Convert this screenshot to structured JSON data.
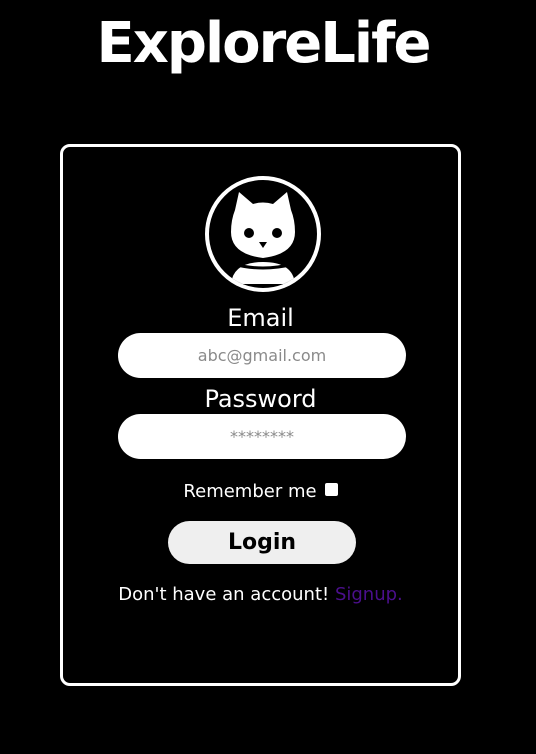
{
  "header": {
    "brand": "ExploreLife"
  },
  "login_form": {
    "avatar_icon": "cat-avatar-icon",
    "email_label": "Email",
    "email_placeholder": "abc@gmail.com",
    "password_label": "Password",
    "password_placeholder": "********",
    "remember_label": "Remember me",
    "remember_checked": false,
    "login_button": "Login",
    "no_account_text": "Don't have an account! ",
    "signup_link": "Signup."
  },
  "colors": {
    "background": "#000000",
    "text": "#ffffff",
    "signup_link": "#4b0f8c",
    "login_button_bg": "#efefef"
  }
}
